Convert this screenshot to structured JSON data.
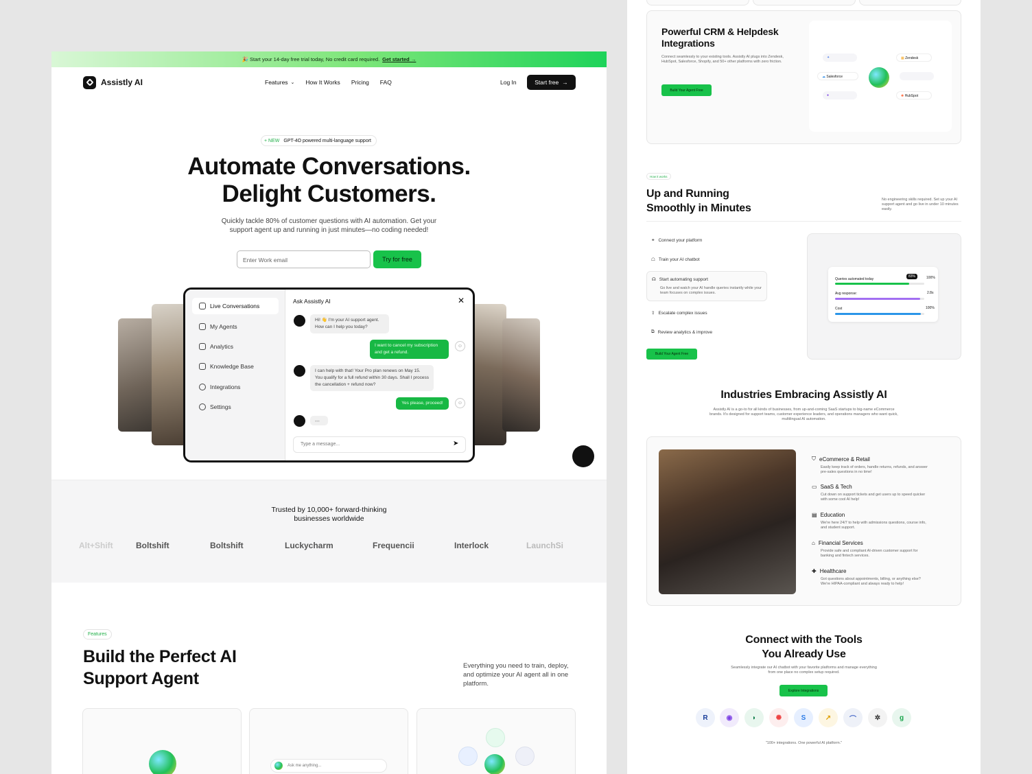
{
  "left": {
    "banner": {
      "text": "🎉 Start your 14-day free trial today, No credit card required.",
      "link": "Get started →"
    },
    "nav": {
      "brand": "Assistly AI",
      "links": [
        "Features",
        "How It Works",
        "Pricing",
        "FAQ"
      ],
      "login": "Log In",
      "cta": "Start free"
    },
    "hero": {
      "badge_new": "+ NEW",
      "badge_text": "GPT-4O powered multi-language support",
      "title_line1": "Automate Conversations.",
      "title_line2": "Delight Customers.",
      "subtitle": "Quickly tackle 80% of customer questions with AI automation. Get your support agent up and running in just minutes—no coding needed!",
      "email_placeholder": "Enter Work email",
      "cta": "Try for free"
    },
    "mockup": {
      "sidebar": [
        "Live Conversations",
        "My Agents",
        "Analytics",
        "Knowledge Base",
        "Integrations",
        "Settings"
      ],
      "chat_title": "Ask Assistly AI",
      "messages": [
        "Hi! 👋 I'm your AI support agent. How can I help you today?",
        "I want to cancel my subscription and get a refund.",
        "I can help with that! Your Pro plan renews on May 15. You qualify for a full refund within 30 days. Shall I process the cancellation + refund now?",
        "Yes please, proceed!"
      ],
      "input_placeholder": "Type a message..."
    },
    "trusted": {
      "title": "Trusted by 10,000+ forward-thinking businesses worldwide",
      "logos": [
        "Alt+Shift",
        "Boltshift",
        "Boltshift",
        "Luckycharm",
        "Frequencii",
        "Interlock",
        "LaunchSi"
      ]
    },
    "features": {
      "pill": "Features",
      "title_line1": "Build the Perfect AI",
      "title_line2": "Support Agent",
      "desc": "Everything you need to train, deploy, and optimize your AI agent all in one platform.",
      "ask_placeholder": "Ask me anything..."
    }
  },
  "right": {
    "crm": {
      "title": "Powerful CRM & Helpdesk Integrations",
      "desc": "Connect seamlessly to your existing tools. Assistly AI plugs into Zendesk, HubSpot, Salesforce, Shopify, and 50+ other platforms with zero friction.",
      "cta": "Build Your Agent Free",
      "tools": [
        "Zendesk",
        "Salesforce",
        "HubSpot"
      ]
    },
    "how": {
      "pill": "How it works",
      "title_line1": "Up and Running",
      "title_line2": "Smoothly in Minutes",
      "side": "No engineering skills required. Set up your AI support agent and go live in under 10 minutes easily.",
      "steps": [
        "Connect your platform",
        "Train your AI chatbot",
        "Start automating support",
        "Escalate complex issues",
        "Review analytics & improve"
      ],
      "active_desc": "Go live and watch your AI handle queries instantly while your team focuses on complex issues.",
      "cta": "Build Your Agent Free",
      "metrics": [
        {
          "label": "Queries automated today",
          "badge": "83%",
          "value": "100%",
          "fill": 0.83
        },
        {
          "label": "Avg response:",
          "value": "2.8s",
          "fill": 0.95
        },
        {
          "label": "Cost",
          "value": "100%",
          "fill": 0.96
        }
      ]
    },
    "industries": {
      "title": "Industries Embracing Assistly AI",
      "desc": "Assistly AI is a go-to for all kinds of businesses, from up-and-coming SaaS startups to big-name eCommerce brands. It's designed for support teams, customer experience leaders, and operations managers who want quick, multilingual AI automation.",
      "items": [
        {
          "name": "eCommerce & Retail",
          "desc": "Easily keep track of orders, handle returns, refunds, and answer pre-sales questions in no time!"
        },
        {
          "name": "SaaS & Tech",
          "desc": "Cut down on support tickets and get users up to speed quicker with some cool AI help!"
        },
        {
          "name": "Education",
          "desc": "We're here 24/7 to help with admissions questions, course info, and student support."
        },
        {
          "name": "Financial Services",
          "desc": "Provide safe and compliant AI-driven customer support for banking and fintech services."
        },
        {
          "name": "Healthcare",
          "desc": "Got questions about appointments, billing, or anything else? We're HIPAA-compliant and always ready to help!"
        }
      ]
    },
    "tools": {
      "title_line1": "Connect with the Tools",
      "title_line2": "You Already Use",
      "desc": "Seamlessly integrate our AI chatbot with your favorite platforms and manage everything from one place no complex setup required.",
      "cta": "Explore Integrations",
      "footer": "\"100+ integrations. One powerful AI platform.\""
    }
  }
}
